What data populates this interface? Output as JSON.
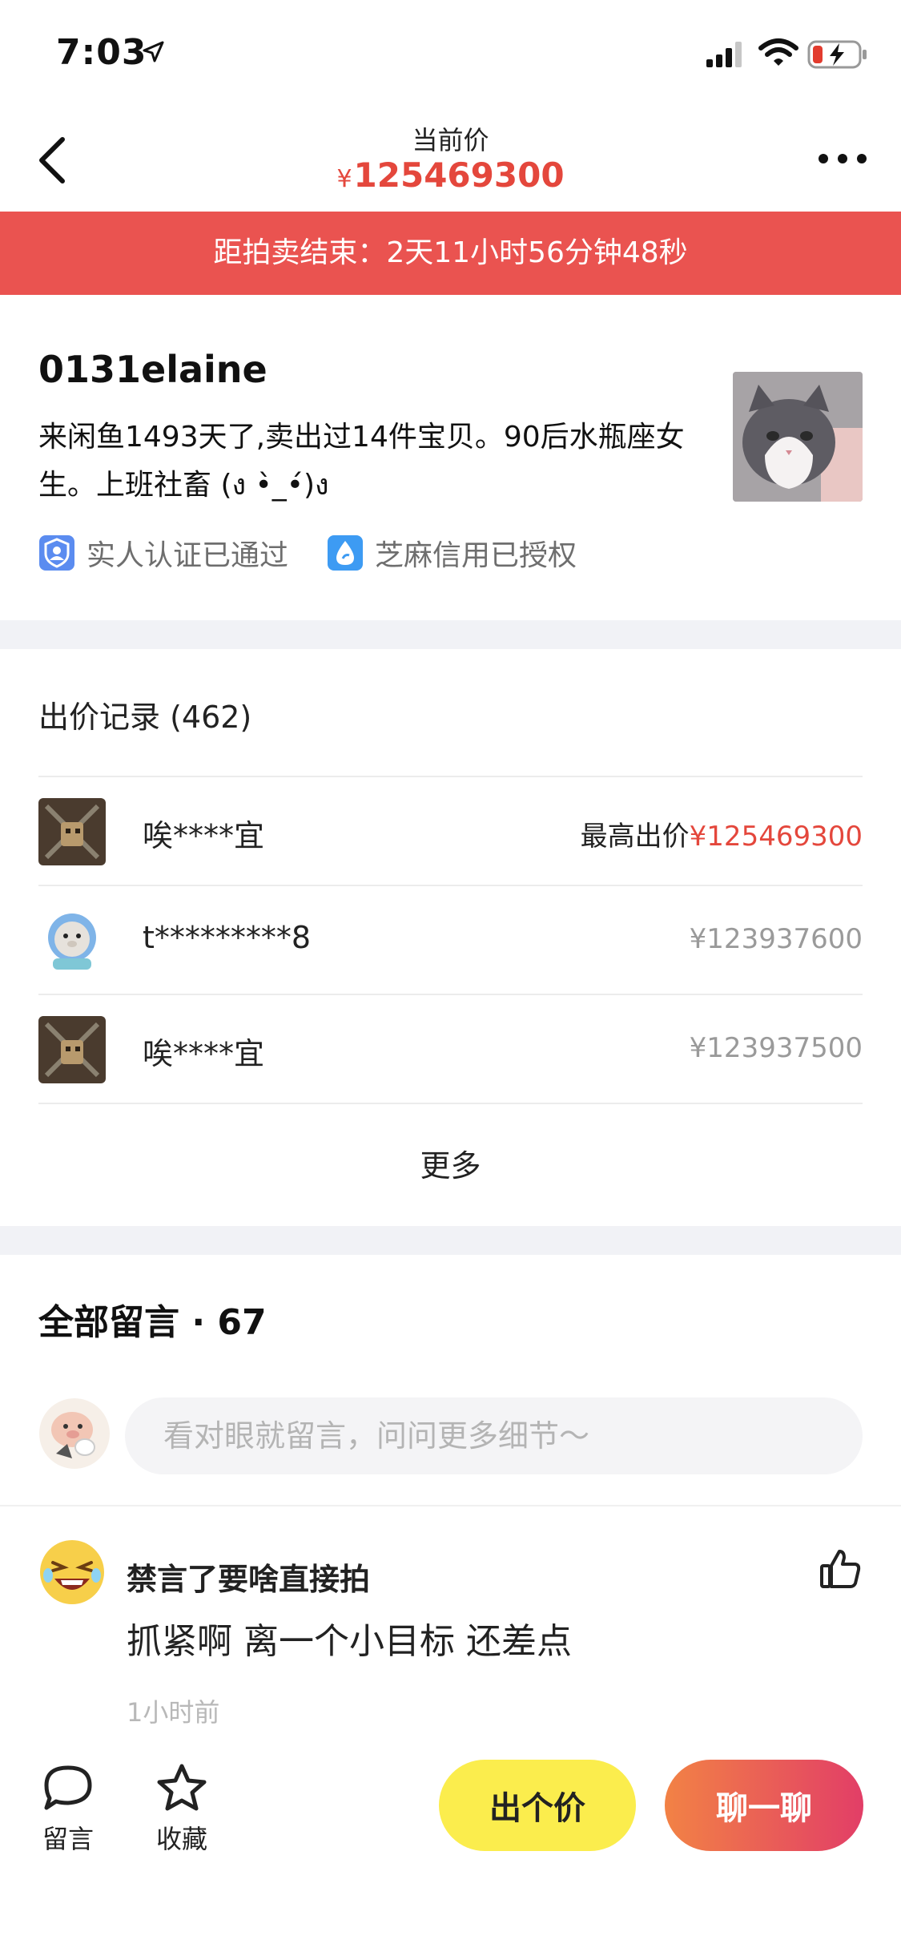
{
  "status_bar": {
    "time": "7:03"
  },
  "nav": {
    "subtitle": "当前价",
    "currency": "¥",
    "price": "125469300"
  },
  "countdown": {
    "text": "距拍卖结束：2天11小时56分钟48秒"
  },
  "seller": {
    "name": "0131elaine",
    "bio": "来闲鱼1493天了,卖出过14件宝贝。90后水瓶座女生。上班社畜 (ง •̀_•́)ง",
    "badges": [
      {
        "label": "实人认证已通过",
        "icon": "id-verified-icon"
      },
      {
        "label": "芝麻信用已授权",
        "icon": "sesame-credit-icon"
      }
    ]
  },
  "bids": {
    "title": "出价记录 (462)",
    "rows": [
      {
        "user": "唉****宜",
        "label": "最高出价",
        "amount": "¥125469300",
        "top": true
      },
      {
        "user": "t*********8",
        "label": "",
        "amount": "¥123937600",
        "top": false
      },
      {
        "user": "唉****宜",
        "label": "",
        "amount": "¥123937500",
        "top": false
      }
    ],
    "more_label": "更多"
  },
  "comments": {
    "title": "全部留言 · 67",
    "input_placeholder": "看对眼就留言，问问更多细节～",
    "items": [
      {
        "user": "禁言了要啥直接拍",
        "text": "抓紧啊 离一个小目标 还差点",
        "time": "1小时前"
      }
    ]
  },
  "bottom_bar": {
    "comment_label": "留言",
    "favorite_label": "收藏",
    "bid_button": "出个价",
    "chat_button": "聊一聊"
  },
  "colors": {
    "accent_red": "#e4473c",
    "banner_red": "#ea5350",
    "bid_button_yellow": "#fbed4d",
    "chat_gradient_start": "#f28245",
    "chat_gradient_end": "#e23e67"
  }
}
